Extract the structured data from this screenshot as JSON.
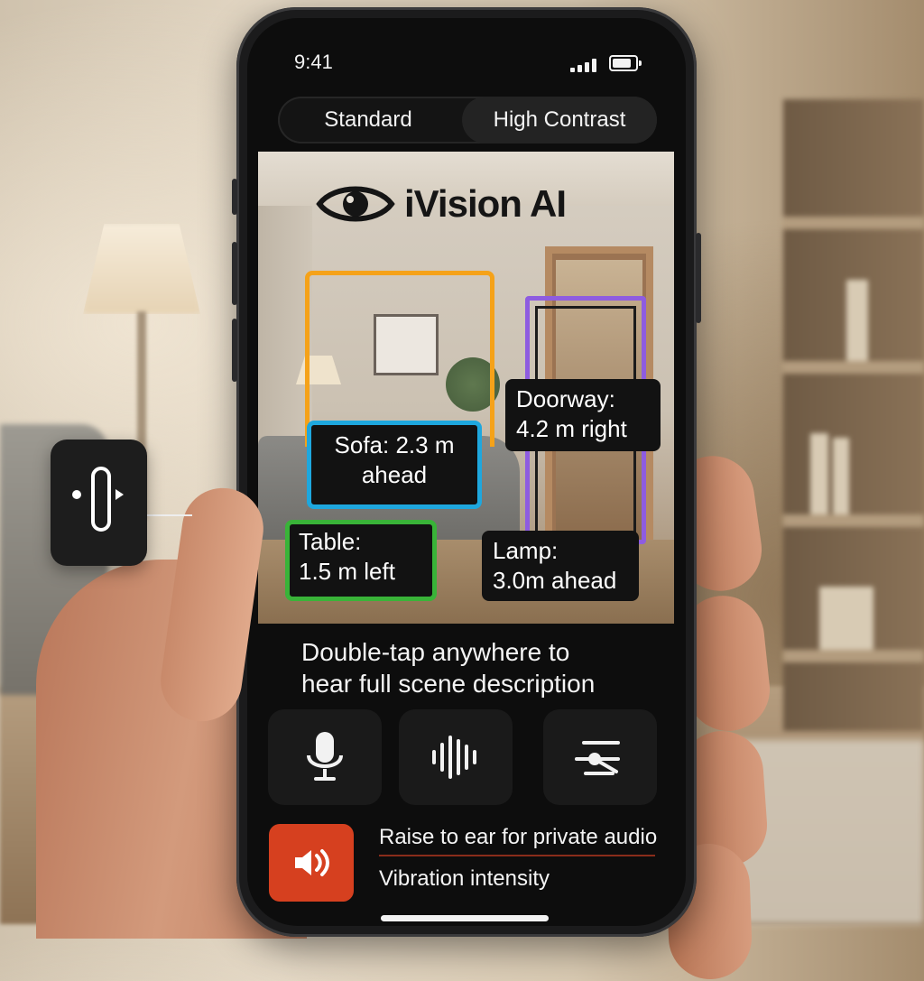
{
  "status_bar": {
    "time": "9:41",
    "signal_icon": "cellular-signal-icon",
    "battery_icon": "battery-icon"
  },
  "mode_toggle": {
    "options": [
      "Standard",
      "High Contrast"
    ],
    "selected": "High Contrast"
  },
  "app": {
    "logo_icon": "eye-icon",
    "name": "iVision AI"
  },
  "detections": {
    "sofa": {
      "line1": "Sofa:   2.3 m",
      "line2": "ahead",
      "color": "#1ea7de"
    },
    "doorway": {
      "line1": "Doorway:",
      "line2": "4.2 m right",
      "color": "#8e5ce0"
    },
    "table": {
      "line1": "Table:",
      "line2": "1.5 m  left",
      "color": "#39b338"
    },
    "lamp": {
      "line1": "Lamp:",
      "line2": "3.0m ahead"
    },
    "highlight_orange": "#f5a219"
  },
  "hint": {
    "line1": "Double-tap anywhere to",
    "line2": "hear full scene description"
  },
  "controls": [
    {
      "icon": "microphone-icon"
    },
    {
      "icon": "audio-waveform-icon"
    },
    {
      "icon": "sliders-icon"
    }
  ],
  "audio": {
    "speaker_icon": "speaker-icon",
    "speaker_color": "#d6401f"
  },
  "settings": {
    "private_audio": "Raise to ear for private audio",
    "vibration": "Vibration intensity"
  },
  "side_control": {
    "icon": "haptic-slider-icon"
  }
}
